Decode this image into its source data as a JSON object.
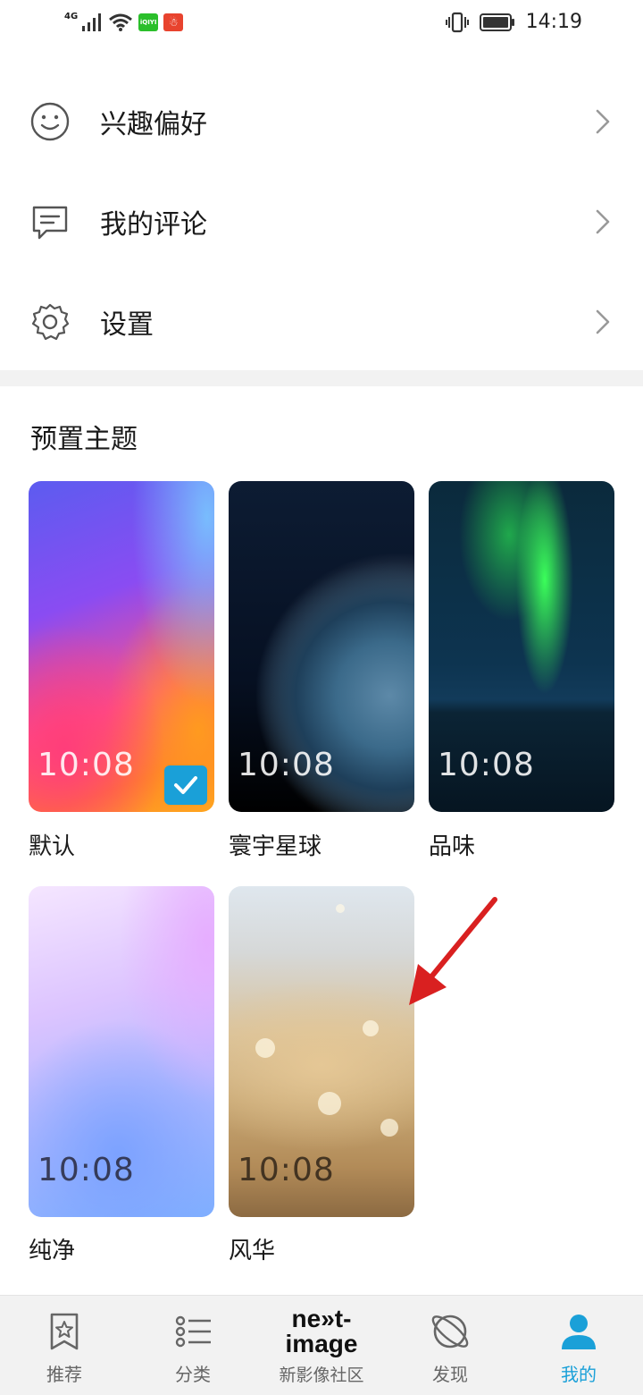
{
  "status_bar": {
    "network": "4G",
    "app_icon_1": "iQIYI",
    "time": "14:19"
  },
  "menu": {
    "items": [
      {
        "label": "兴趣偏好",
        "icon": "smiley-icon"
      },
      {
        "label": "我的评论",
        "icon": "comment-icon"
      },
      {
        "label": "设置",
        "icon": "gear-icon"
      }
    ]
  },
  "themes": {
    "title": "预置主题",
    "clock": "10:08",
    "items": [
      {
        "name": "默认",
        "selected": true
      },
      {
        "name": "寰宇星球",
        "selected": false
      },
      {
        "name": "品味",
        "selected": false
      },
      {
        "name": "纯净",
        "selected": false
      },
      {
        "name": "风华",
        "selected": false
      }
    ]
  },
  "bottom_nav": {
    "items": [
      {
        "label": "推荐",
        "icon": "bookmark-star-icon",
        "active": false
      },
      {
        "label": "分类",
        "icon": "list-icon",
        "active": false
      },
      {
        "label": "新影像社区",
        "icon": "next-image-logo",
        "active": false
      },
      {
        "label": "发现",
        "icon": "planet-icon",
        "active": false
      },
      {
        "label": "我的",
        "icon": "person-icon",
        "active": true
      }
    ],
    "brand_logo_line1": "ne»t-",
    "brand_logo_line2": "image"
  },
  "colors": {
    "accent": "#1aa0d8",
    "annotation_arrow": "#d92020"
  }
}
